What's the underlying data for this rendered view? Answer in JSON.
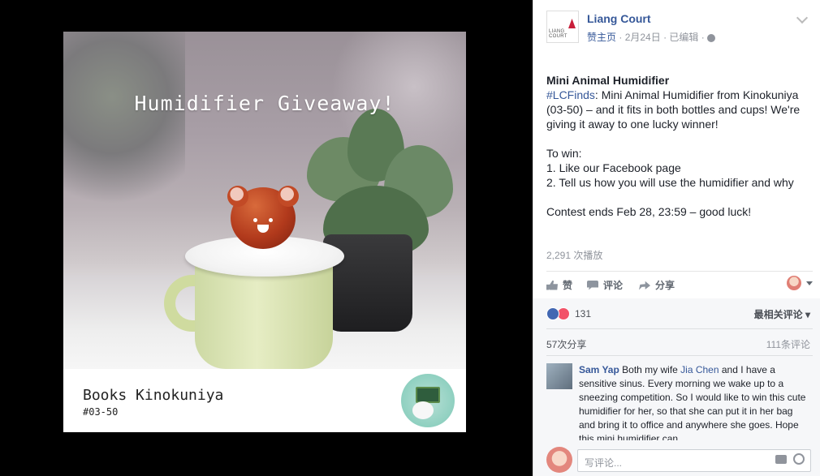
{
  "media": {
    "headline": "Humidifier Giveaway!",
    "store_name": "Books Kinokuniya",
    "store_unit": "#03-50"
  },
  "page": {
    "name": "Liang Court",
    "logo_text": "LIANG COURT",
    "author": "赞主页",
    "date": "2月24日",
    "edited": "已编辑"
  },
  "post": {
    "title": "Mini Animal Humidifier",
    "hashtag": "#LCFinds",
    "line1": ": Mini Animal Humidifier from Kinokuniya (03-50) – and it fits in both bottles and cups! We're giving it away to one lucky winner!",
    "to_win": "To win:",
    "step1": "1. Like our Facebook page",
    "step2": "2. Tell us how you will use the humidifier and why",
    "ending": "Contest ends Feb 28, 23:59 – good luck!"
  },
  "stats": {
    "views": "2,291 次播放",
    "reactions": "131",
    "sort": "最相关评论",
    "shares": "57次分享",
    "comments": "111条评论"
  },
  "actions": {
    "like": "赞",
    "comment": "评论",
    "share": "分享"
  },
  "comment": {
    "author": "Sam Yap",
    "text_a": " Both my wife ",
    "mention": "Jia Chen",
    "text_b": " and I have a sensitive sinus. Every morning we wake up to a sneezing competition. So I would like to win this cute humidifier for her, so that she can put it in her bag and bring it to office and anywhere she goes. Hope this mini humidifier can"
  },
  "composer": {
    "placeholder": "写评论..."
  },
  "colors": {
    "link": "#365899",
    "like": "#4267b2",
    "love": "#f25268"
  }
}
